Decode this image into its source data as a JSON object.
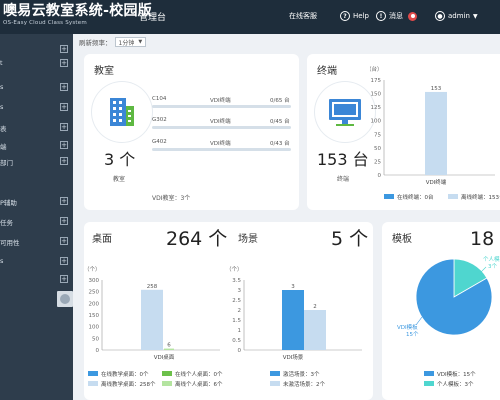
{
  "topbar": {
    "title": "噢易云教室系统-校园版",
    "subtitle": "OS-Easy Cloud Class System",
    "admin_label": "管理台",
    "online_service": "在线客服",
    "help": "Help",
    "messages": "消息",
    "user": "admin"
  },
  "sidebar": {
    "items": [
      {
        "label": ""
      },
      {
        "label": "t"
      },
      {
        "label": "s"
      },
      {
        "label": "s"
      },
      {
        "label": "表"
      },
      {
        "label": "端"
      },
      {
        "label": "部门"
      },
      {
        "label": "P辅助"
      },
      {
        "label": "任务"
      },
      {
        "label": "可用性"
      },
      {
        "label": "s"
      },
      {
        "label": ""
      }
    ]
  },
  "filter": {
    "label": "刷新频率：",
    "value": "1分钟"
  },
  "classroom": {
    "title": "教室",
    "count": "3 个",
    "caption": "教室",
    "footer": "VDI教室：3个",
    "rooms": [
      {
        "name": "C104",
        "type": "VDI终端",
        "usage": "0/65 台"
      },
      {
        "name": "G302",
        "type": "VDI终端",
        "usage": "0/45 台"
      },
      {
        "name": "G402",
        "type": "VDI终端",
        "usage": "0/43 台"
      }
    ]
  },
  "terminal": {
    "title": "终端",
    "count": "153 台",
    "caption": "终端",
    "legend": [
      "在线终端：0台",
      "离线终端：153台"
    ],
    "chart_data": {
      "type": "bar",
      "categories": [
        "VDI终端"
      ],
      "series": [
        {
          "name": "在线终端",
          "values": [
            0
          ]
        },
        {
          "name": "离线终端",
          "values": [
            153
          ]
        }
      ],
      "ylabel": "（台）",
      "ylim": [
        0,
        175
      ],
      "yticks": [
        "175",
        "150",
        "125",
        "100",
        "75",
        "50",
        "25",
        "0"
      ]
    }
  },
  "desktop": {
    "title": "桌面",
    "count": "264 个",
    "legend": [
      "在线教学桌面：0个",
      "在线个人桌面：0个",
      "离线教学桌面：258个",
      "离线个人桌面：6个"
    ],
    "chart_data": {
      "type": "bar",
      "categories": [
        "VDI桌面"
      ],
      "series": [
        {
          "name": "在线教学桌面",
          "values": [
            0
          ]
        },
        {
          "name": "在线个人桌面",
          "values": [
            0
          ]
        },
        {
          "name": "离线教学桌面",
          "values": [
            258
          ]
        },
        {
          "name": "离线个人桌面",
          "values": [
            6
          ]
        }
      ],
      "ylabel": "（个）",
      "ylim": [
        0,
        300
      ],
      "yticks": [
        "300",
        "250",
        "200",
        "150",
        "100",
        "50",
        "0"
      ]
    }
  },
  "scene": {
    "title": "场景",
    "count": "5 个",
    "legend": [
      "激活场景：3个",
      "未激活场景：2个"
    ],
    "chart_data": {
      "type": "bar",
      "categories": [
        "VDI场景"
      ],
      "series": [
        {
          "name": "激活场景",
          "values": [
            3
          ]
        },
        {
          "name": "未激活场景",
          "values": [
            2
          ]
        }
      ],
      "ylabel": "（个）",
      "ylim": [
        0,
        3.5
      ],
      "yticks": [
        "3.5",
        "3",
        "2.5",
        "2",
        "1.5",
        "1",
        "0.5",
        "0"
      ]
    }
  },
  "template": {
    "title": "模板",
    "count": "18 个",
    "legend": [
      "VDI模板：15个",
      "个人模板：3个"
    ],
    "chart_data": {
      "type": "pie",
      "slices": [
        {
          "name": "VDI模板",
          "value": 15,
          "label": "VDI模板",
          "sublabel": "15个"
        },
        {
          "name": "个人模板",
          "value": 3,
          "label": "个人模板",
          "sublabel": "3个"
        }
      ]
    }
  },
  "colors": {
    "topbar": "#1e2d3b",
    "sidebar": "#2e3d4c",
    "blue": "#3c98e0",
    "light_blue": "#c6dcf0",
    "green": "#6cc04a",
    "light_green": "#b4e4a0",
    "cyan": "#4fd6cf"
  }
}
